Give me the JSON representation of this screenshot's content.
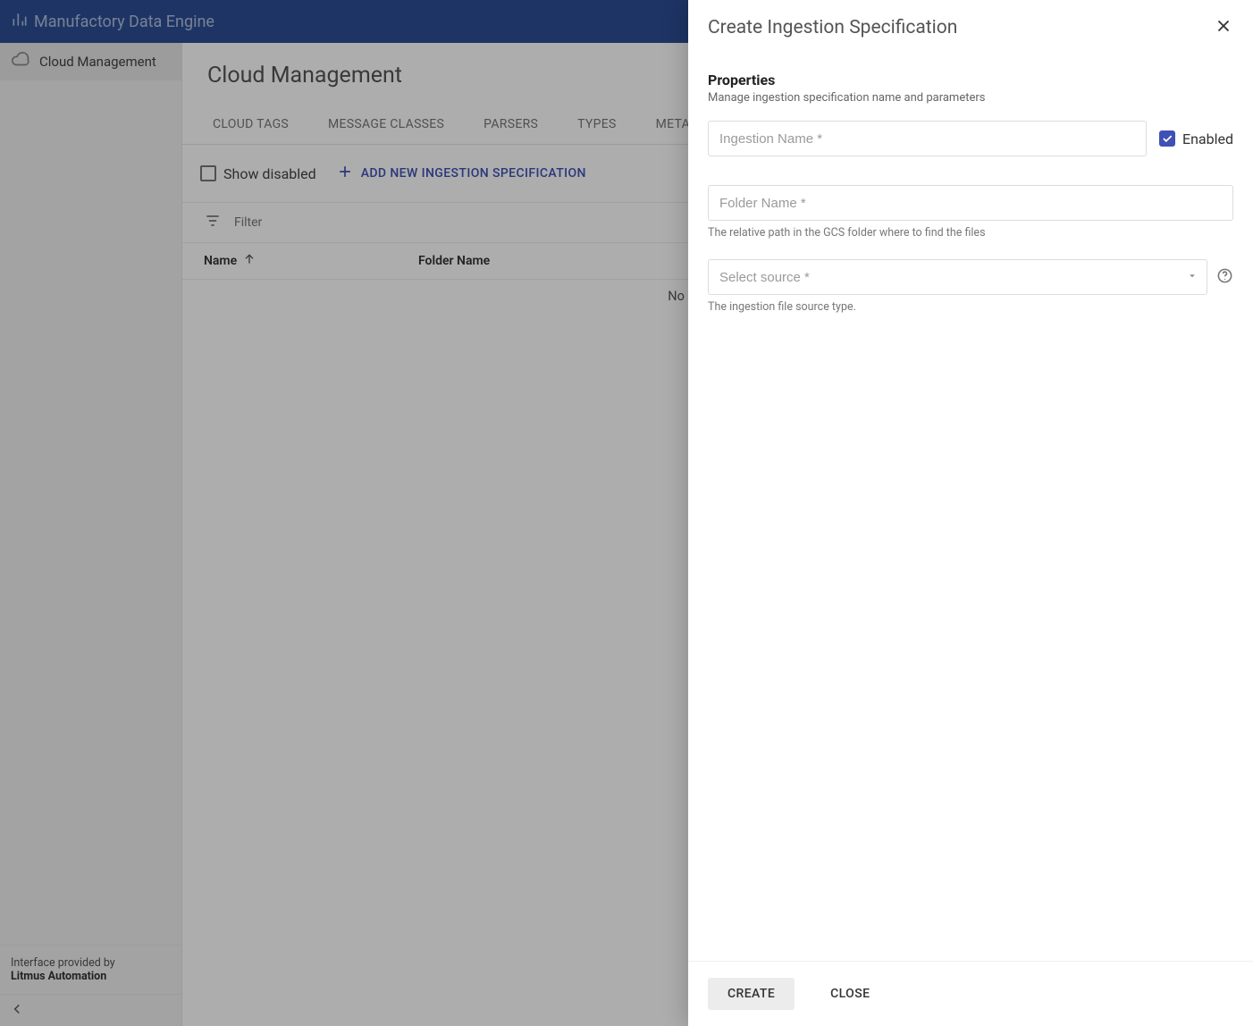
{
  "app": {
    "name": "Manufactory Data Engine"
  },
  "sidebar": {
    "items": [
      {
        "label": "Cloud Management"
      }
    ],
    "footer_line1": "Interface provided by",
    "footer_line2": "Litmus Automation"
  },
  "page": {
    "title": "Cloud Management",
    "tabs": [
      "CLOUD TAGS",
      "MESSAGE CLASSES",
      "PARSERS",
      "TYPES",
      "METADATA"
    ],
    "show_disabled_label": "Show disabled",
    "add_button_label": "ADD NEW INGESTION SPECIFICATION",
    "filter_label": "Filter",
    "columns": {
      "name": "Name",
      "folder": "Folder Name"
    },
    "empty_text": "No available data"
  },
  "drawer": {
    "title": "Create Ingestion Specification",
    "section_title": "Properties",
    "section_desc": "Manage ingestion specification name and parameters",
    "ingestion_name_placeholder": "Ingestion Name *",
    "enabled_label": "Enabled",
    "enabled_checked": true,
    "folder_placeholder": "Folder Name *",
    "folder_helper": "The relative path in the GCS folder where to find the files",
    "source_placeholder": "Select source *",
    "source_helper": "The ingestion file source type.",
    "create_label": "CREATE",
    "close_label": "CLOSE"
  }
}
